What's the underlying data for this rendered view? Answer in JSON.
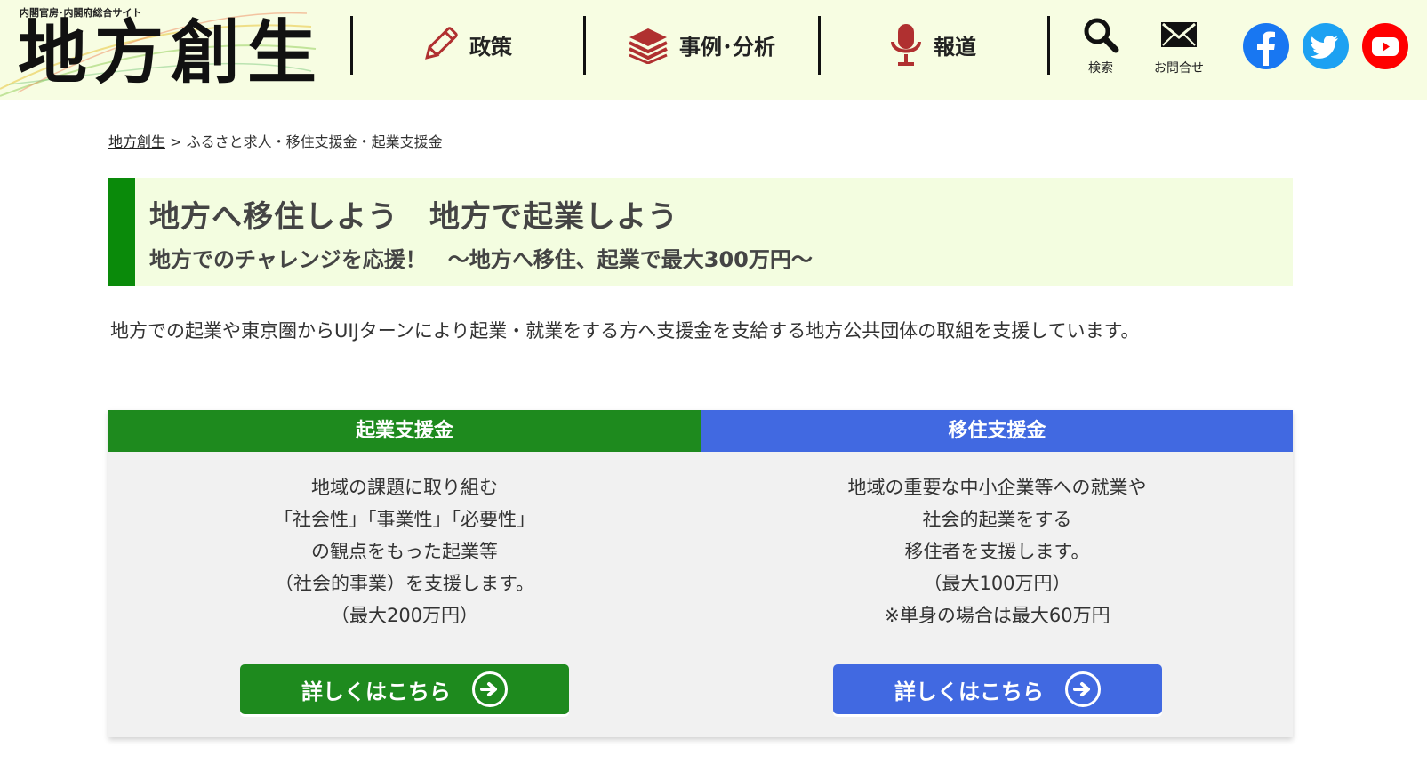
{
  "header": {
    "logo_subtitle": "内閣官房･内閣府総合サイト",
    "logo_title": "地方創生",
    "nav": [
      {
        "label": "政策",
        "icon": "pencil-icon"
      },
      {
        "label": "事例･分析",
        "icon": "book-stack-icon"
      },
      {
        "label": "報道",
        "icon": "microphone-icon"
      }
    ],
    "utility": [
      {
        "label": "検索",
        "icon": "search-icon"
      },
      {
        "label": "お問合せ",
        "icon": "mail-icon"
      }
    ],
    "social": [
      {
        "icon": "facebook-icon",
        "color": "#1877f2"
      },
      {
        "icon": "twitter-icon",
        "color": "#1da1f2"
      },
      {
        "icon": "youtube-icon",
        "color": "#ff0000"
      }
    ]
  },
  "breadcrumb": {
    "home": "地方創生",
    "separator": ">",
    "current": "ふるさと求人・移住支援金・起業支援金"
  },
  "banner": {
    "title": "地方へ移住しよう　地方で起業しよう",
    "subtitle": "地方でのチャレンジを応援！　～地方へ移住、起業で最大300万円～"
  },
  "intro": "地方での起業や東京圏からUIJターンにより起業・就業をする方へ支援金を支給する地方公共団体の取組を支援しています。",
  "cards": [
    {
      "title": "起業支援金",
      "color": "#1e8a1e",
      "lines": [
        "地域の課題に取り組む",
        "「社会性」「事業性」「必要性」",
        "の観点をもった起業等",
        "（社会的事業）を支援します。",
        "（最大200万円）"
      ],
      "button": "詳しくはこちら"
    },
    {
      "title": "移住支援金",
      "color": "#4169e1",
      "lines": [
        "地域の重要な中小企業等への就業や",
        "社会的起業をする",
        "移住者を支援します。",
        "（最大100万円）",
        "※単身の場合は最大60万円"
      ],
      "button": "詳しくはこちら"
    }
  ]
}
